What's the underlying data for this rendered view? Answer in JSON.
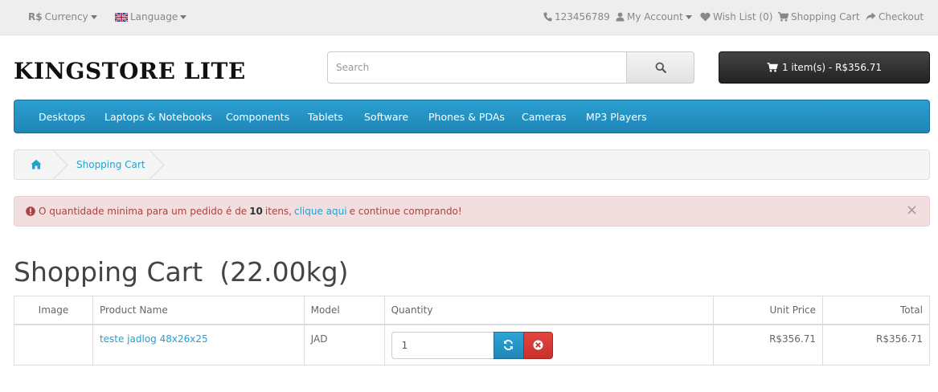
{
  "topbar": {
    "currency_symbol": "R$",
    "currency_label": "Currency",
    "language_label": "Language",
    "phone": "123456789",
    "my_account": "My Account",
    "wish_list": "Wish List (0)",
    "shopping_cart": "Shopping Cart",
    "checkout": "Checkout"
  },
  "header": {
    "logo": "KINGSTORE LITE",
    "search_placeholder": "Search",
    "cart_summary": "1 item(s) - R$356.71"
  },
  "nav": {
    "items": [
      "Desktops",
      "Laptops & Notebooks",
      "Components",
      "Tablets",
      "Software",
      "Phones & PDAs",
      "Cameras",
      "MP3 Players"
    ]
  },
  "breadcrumb": {
    "current": "Shopping Cart"
  },
  "alert": {
    "text_before": "O quantidade minima para um pedido é de",
    "min_qty": "10",
    "text_mid": "itens,",
    "link": "clique aqui",
    "text_after": "e continue comprando!",
    "close": "×"
  },
  "page": {
    "title": "Shopping Cart  (22.00kg)"
  },
  "table": {
    "headers": {
      "image": "Image",
      "product": "Product Name",
      "model": "Model",
      "quantity": "Quantity",
      "unit_price": "Unit Price",
      "total": "Total"
    },
    "rows": [
      {
        "product": "teste jadlog 48x26x25",
        "model": "JAD",
        "quantity": "1",
        "unit_price": "R$356.71",
        "total": "R$356.71"
      }
    ]
  },
  "colors": {
    "nav_blue": "#229ac8",
    "link_blue": "#23a1d1",
    "alert_bg": "#f2dede",
    "alert_text": "#a94442",
    "remove_red": "#d9534f"
  },
  "icons": {
    "phone": "phone-icon",
    "account": "user-icon",
    "wishlist": "heart-icon",
    "cart": "cart-icon",
    "checkout": "share-icon",
    "search": "search-icon",
    "home": "home-icon",
    "alert": "exclamation-circle-icon",
    "update": "refresh-icon",
    "remove": "remove-icon"
  }
}
